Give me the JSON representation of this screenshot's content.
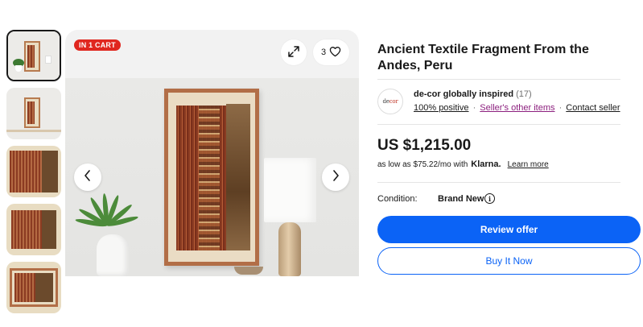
{
  "gallery": {
    "badge": "IN 1 CART",
    "watch_count": "3",
    "icons": {
      "expand": "expand-icon",
      "watch": "heart-icon",
      "prev": "chevron-left-icon",
      "next": "chevron-right-icon"
    }
  },
  "listing": {
    "title": "Ancient Textile Fragment From the Andes, Peru",
    "price": "US $1,215.00",
    "klarna": {
      "prefix": "as low as $75.22/mo with",
      "brand": "Klarna.",
      "link": "Learn more"
    },
    "condition": {
      "label": "Condition:",
      "value": "Brand New"
    }
  },
  "seller": {
    "logo_text_a": "de",
    "logo_text_b": "cor",
    "name": "de-cor globally inspired",
    "feedback_count": "(17)",
    "positive": "100% positive",
    "other_items": "Seller's other items",
    "contact": "Contact seller",
    "separator": "·"
  },
  "actions": {
    "review_offer": "Review offer",
    "buy_now": "Buy It Now"
  },
  "colors": {
    "primary_blue": "#0b63f6",
    "badge_red": "#e0271f",
    "seller_link_purple": "#8c1f7e"
  }
}
